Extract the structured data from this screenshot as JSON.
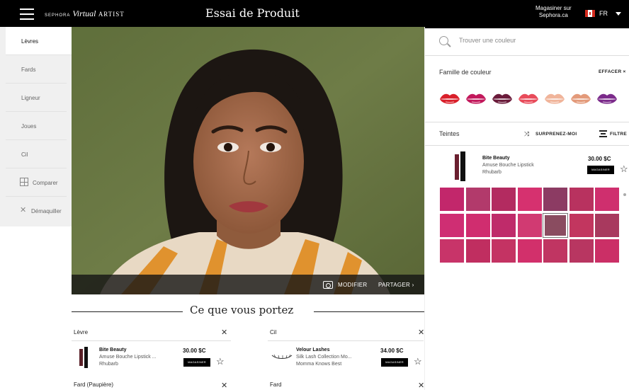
{
  "topbar": {
    "brand_sephora": "SEPHORA",
    "brand_virtual": "Virtual",
    "brand_artist": "ARTIST",
    "title": "Essai de Produit",
    "shop_line1": "Magasiner sur",
    "shop_line2": "Sephora.ca",
    "language": "FR"
  },
  "leftnav": {
    "items": [
      {
        "label": "Lèvres"
      },
      {
        "label": "Fards"
      },
      {
        "label": "Ligneur"
      },
      {
        "label": "Joues"
      },
      {
        "label": "Cil"
      },
      {
        "label": "Comparer"
      },
      {
        "label": "Démaquiller"
      }
    ],
    "active_index": 0
  },
  "photo": {
    "modify_label": "MODIFIER",
    "share_label": "PARTAGER ›"
  },
  "wearing": {
    "title": "Ce que vous portez",
    "entries": [
      {
        "category": "Lèvre",
        "brand": "Bite Beauty",
        "name": "Amuse Bouche Lipstick ...",
        "shade": "Rhubarb",
        "price": "30.00 $C",
        "shop_label": "MAGASINER"
      },
      {
        "category": "Cil",
        "brand": "Velour Lashes",
        "name": "Silk Lash Collection Mo...",
        "shade": "Momma Knows Best",
        "price": "34.00 $C",
        "shop_label": "MAGASINER"
      }
    ],
    "next_categories": [
      "Fard (Paupière)",
      "Fard"
    ]
  },
  "right": {
    "search_placeholder": "Trouver une couleur",
    "family_label": "Famille de couleur",
    "clear_label": "EFFACER ×",
    "lip_colors": [
      "#d91f2a",
      "#c2185b",
      "#6a1b3a",
      "#e84b5a",
      "#f0b49a",
      "#e39a7a",
      "#7b2a8a"
    ],
    "shades_label": "Teintes",
    "surprise_label": "SURPRENEZ-MOI",
    "filter_label": "FILTRE",
    "product": {
      "brand": "Bite Beauty",
      "name": "Amuse Bouche Lipstick",
      "shade": "Rhubarb",
      "price": "30.00 $C",
      "shop_label": "MAGASINER"
    },
    "swatches": [
      [
        "#c2276b",
        "#b23a6b",
        "#b32b60",
        "#d6316f",
        "#8c3b63",
        "#b8325f",
        "#cf2f6e"
      ],
      [
        "#cf2e73",
        "#d02d6f",
        "#bf2b6a",
        "#d13a72",
        "#8a4c60",
        "#c2365f",
        "#a8395e"
      ],
      [
        "#c83469",
        "#c02e60",
        "#c43363",
        "#d2306b",
        "#c03562",
        "#b83661",
        "#cb2f66"
      ]
    ],
    "selected_swatch": [
      1,
      4
    ]
  }
}
